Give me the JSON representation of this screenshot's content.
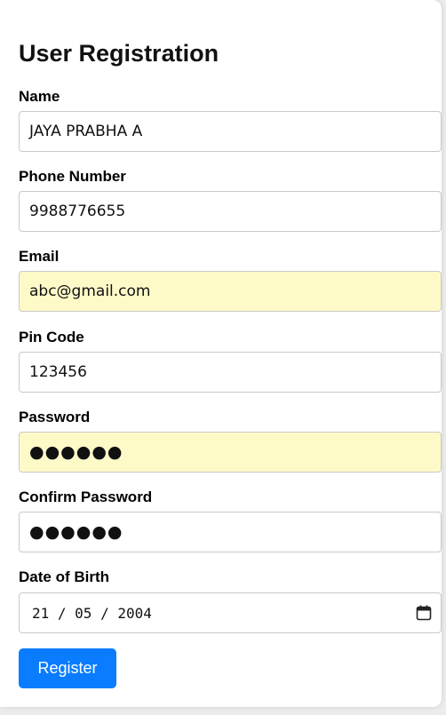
{
  "form": {
    "title": "User Registration",
    "fields": [
      {
        "label": "Name",
        "value": "JAYA PRABHA A"
      },
      {
        "label": "Phone Number",
        "value": "9988776655"
      },
      {
        "label": "Email",
        "value": "abc@gmail.com"
      },
      {
        "label": "Pin Code",
        "value": "123456"
      },
      {
        "label": "Password",
        "value": "●●●●●●"
      },
      {
        "label": "Confirm Password",
        "value": "●●●●●●"
      },
      {
        "label": "Date of Birth",
        "day": "21",
        "month": "05",
        "year": "2004",
        "separator": " / "
      }
    ],
    "submit_label": "Register"
  },
  "icons": {
    "date_picker": "calendar-icon"
  },
  "colors": {
    "accent": "#0a7cff",
    "autofill_bg": "#fefac8"
  }
}
